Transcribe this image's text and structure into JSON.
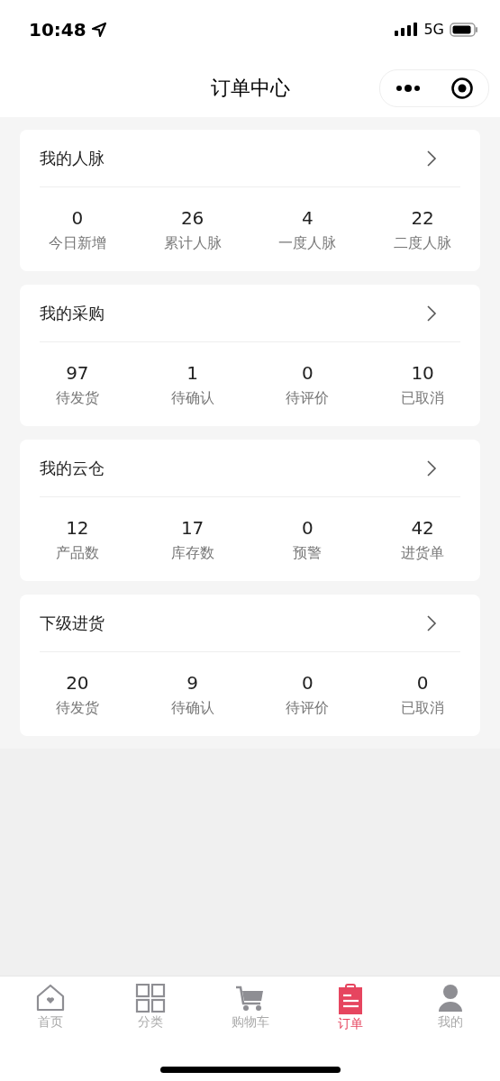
{
  "status_bar": {
    "time": "10:48",
    "network": "5G"
  },
  "nav": {
    "title": "订单中心"
  },
  "sections": [
    {
      "title": "我的人脉",
      "stats": [
        {
          "value": "0",
          "label": "今日新增"
        },
        {
          "value": "26",
          "label": "累计人脉"
        },
        {
          "value": "4",
          "label": "一度人脉"
        },
        {
          "value": "22",
          "label": "二度人脉"
        }
      ]
    },
    {
      "title": "我的采购",
      "stats": [
        {
          "value": "97",
          "label": "待发货"
        },
        {
          "value": "1",
          "label": "待确认"
        },
        {
          "value": "0",
          "label": "待评价"
        },
        {
          "value": "10",
          "label": "已取消"
        }
      ]
    },
    {
      "title": "我的云仓",
      "stats": [
        {
          "value": "12",
          "label": "产品数"
        },
        {
          "value": "17",
          "label": "库存数"
        },
        {
          "value": "0",
          "label": "预警"
        },
        {
          "value": "42",
          "label": "进货单"
        }
      ]
    },
    {
      "title": "下级进货",
      "stats": [
        {
          "value": "20",
          "label": "待发货"
        },
        {
          "value": "9",
          "label": "待确认"
        },
        {
          "value": "0",
          "label": "待评价"
        },
        {
          "value": "0",
          "label": "已取消"
        }
      ]
    }
  ],
  "tab_bar": [
    {
      "kind": "home",
      "label": "首页",
      "selected": false
    },
    {
      "kind": "grid",
      "label": "分类",
      "selected": false
    },
    {
      "kind": "cart",
      "label": "购物车",
      "selected": false
    },
    {
      "kind": "clipboard",
      "label": "订单",
      "selected": true
    },
    {
      "kind": "person",
      "label": "我的",
      "selected": false
    }
  ]
}
